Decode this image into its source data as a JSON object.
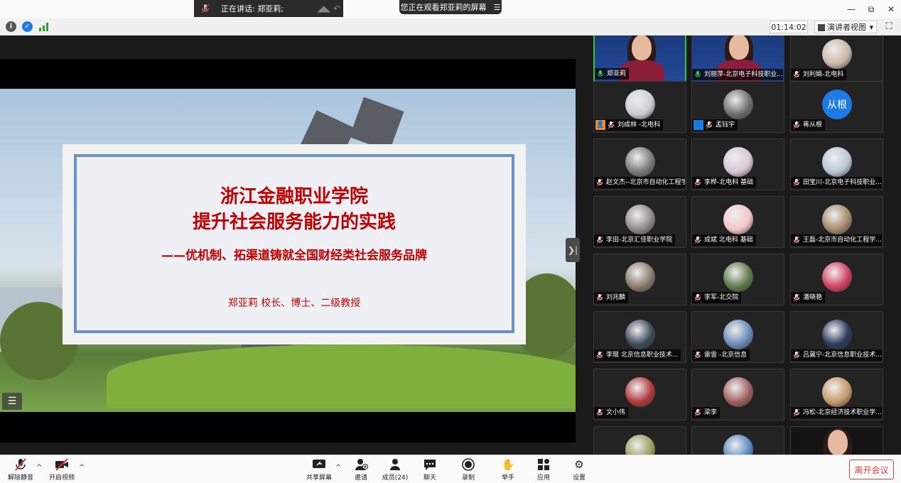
{
  "titlebar": {
    "speaking_label": "正在讲话: 郑亚莉;",
    "viewing_label": "您正在观看郑亚莉的屏幕",
    "minimize": "—",
    "restore": "⧉",
    "close": "✕"
  },
  "toptool": {
    "timer": "01:14:02",
    "view_label": "演讲者视图",
    "view_caret": "▾",
    "fullscreen": "⛶"
  },
  "slide": {
    "title_line1": "浙江金融职业学院",
    "title_line2": "提升社会服务能力的实践",
    "subtitle": "——优机制、拓渠道铸就全国财经类社会服务品牌",
    "author": "郑亚莉   校长、博士、二级教授"
  },
  "participants": [
    {
      "name": "郑亚莉",
      "kind": "video",
      "active": true
    },
    {
      "name": "刘丽萍-北京电子科技职业...",
      "kind": "video-female"
    },
    {
      "name": "刘利娟-北电科",
      "kind": "photo",
      "color": "#c9b8a8"
    },
    {
      "name": "刘成林 -北电科",
      "kind": "photo",
      "color": "#c8cdd5",
      "badge": "orange"
    },
    {
      "name": "孟钰宇",
      "kind": "photo",
      "color": "#6e6e6e",
      "badge": "blue"
    },
    {
      "name": "蒋从根",
      "kind": "text",
      "avatar_text": "从根"
    },
    {
      "name": "赵文杰--北京市自动化工程学...",
      "kind": "photo",
      "color": "#7a7a7a"
    },
    {
      "name": "李桦-北电科 基础",
      "kind": "photo",
      "color": "#d9c6d6"
    },
    {
      "name": "田宝川-北京电子科技职业...",
      "kind": "photo",
      "color": "#b9c8d8"
    },
    {
      "name": "李田-北京汇佳职业学院",
      "kind": "photo",
      "color": "#8f8a86"
    },
    {
      "name": "成斌 北电科 基础",
      "kind": "photo",
      "color": "#f4c6c8"
    },
    {
      "name": "王磊-北京市自动化工程学...",
      "kind": "photo",
      "color": "#a58a6a"
    },
    {
      "name": "刘兆麟",
      "kind": "photo",
      "color": "#8a7a6a"
    },
    {
      "name": "李军-北交院",
      "kind": "photo",
      "color": "#5e7a4a"
    },
    {
      "name": "潘晓艳",
      "kind": "photo",
      "color": "#d04060"
    },
    {
      "name": "李琨 北京信息职业技术...",
      "kind": "photo",
      "color": "#3a4a5a"
    },
    {
      "name": "雷雲 -北京信息",
      "kind": "photo",
      "color": "#6a8ab8"
    },
    {
      "name": "吕冀宁-北京信息职业技术...",
      "kind": "photo",
      "color": "#2a3a5a"
    },
    {
      "name": "文小伟",
      "kind": "photo",
      "color": "#b03a3a"
    },
    {
      "name": "梁李",
      "kind": "photo",
      "color": "#a06060"
    },
    {
      "name": "冯松-北京经济技术职业学...",
      "kind": "photo",
      "color": "#c49a6a"
    },
    {
      "name": "",
      "kind": "photo",
      "color": "#9aa060"
    },
    {
      "name": "",
      "kind": "photo",
      "color": "#5a8ac0"
    },
    {
      "name": "",
      "kind": "video-female-dark"
    }
  ],
  "bottombar": {
    "unmute": "解除静音",
    "start_video": "开启视频",
    "share_screen": "共享屏幕",
    "invite": "邀请",
    "members": "成员(24)",
    "chat": "聊天",
    "record": "录制",
    "raise_hand": "举手",
    "apps": "应用",
    "settings": "设置",
    "leave": "离开会议"
  }
}
